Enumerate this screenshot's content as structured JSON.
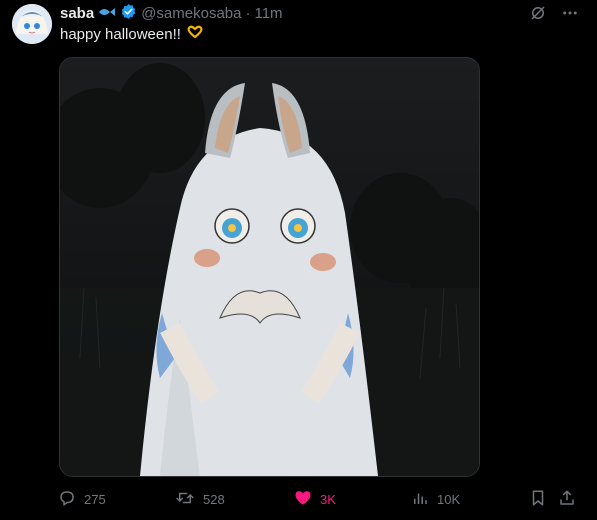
{
  "post": {
    "author_name": "saba",
    "author_handle": "@samekosaba",
    "separator": "·",
    "time": "11m",
    "text": "happy halloween!!",
    "emoji_icon": "heart-hands-icon",
    "media_alt_icons": [
      "ghost-character-image"
    ]
  },
  "actions": {
    "replies": "275",
    "reposts": "528",
    "likes": "3K",
    "views": "10K"
  },
  "colors": {
    "background": "#000000",
    "text": "#e7e9ea",
    "muted": "#71767b",
    "like_active": "#f91880",
    "verified": "#1d9bf0",
    "emoji": "#f3b400"
  }
}
